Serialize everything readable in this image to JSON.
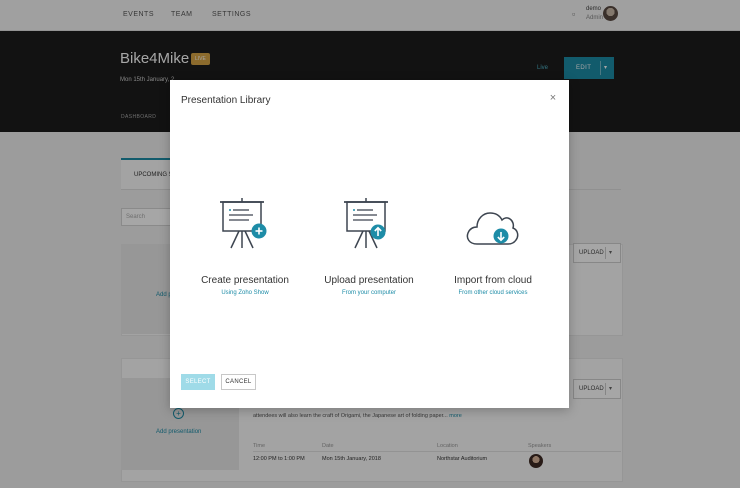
{
  "nav": {
    "items": [
      "EVENTS",
      "TEAM",
      "SETTINGS"
    ]
  },
  "user": {
    "name": "demo",
    "role": "Admin"
  },
  "event": {
    "title": "Bike4Mike",
    "badge": "LIVE",
    "date": "Mon 15th January, 2",
    "dashboard_tab": "DASHBOARD",
    "live_link": "Live",
    "edit_label": "EDIT"
  },
  "background": {
    "upcoming_tab": "UPCOMING S",
    "search_placeholder": "Search",
    "add_short": "Add p",
    "upload_label": "UPLOAD",
    "add_presentation": "Add presentation",
    "description": "attendees will also learn the craft of Origami, the Japanese art of folding paper...",
    "more": "more",
    "meta": {
      "time_label": "Time",
      "time_value": "12:00 PM to 1:00 PM",
      "date_label": "Date",
      "date_value": "Mon 15th January, 2018",
      "location_label": "Location",
      "location_value": "Northstar Auditorium",
      "speakers_label": "Speakers"
    }
  },
  "modal": {
    "title": "Presentation Library",
    "close_icon": "close-icon",
    "options": [
      {
        "title": "Create presentation",
        "subtitle": "Using Zoho Show",
        "icon": "easel-plus-icon"
      },
      {
        "title": "Upload presentation",
        "subtitle": "From your computer",
        "icon": "easel-upload-icon"
      },
      {
        "title": "Import from cloud",
        "subtitle": "From other cloud services",
        "icon": "cloud-download-icon"
      }
    ],
    "select_label": "SELECT",
    "cancel_label": "CANCEL"
  },
  "colors": {
    "accent": "#1d8ca7",
    "badge": "#d7a545",
    "header_bg": "#1c1c1c",
    "select_disabled": "#9fdbe8"
  }
}
